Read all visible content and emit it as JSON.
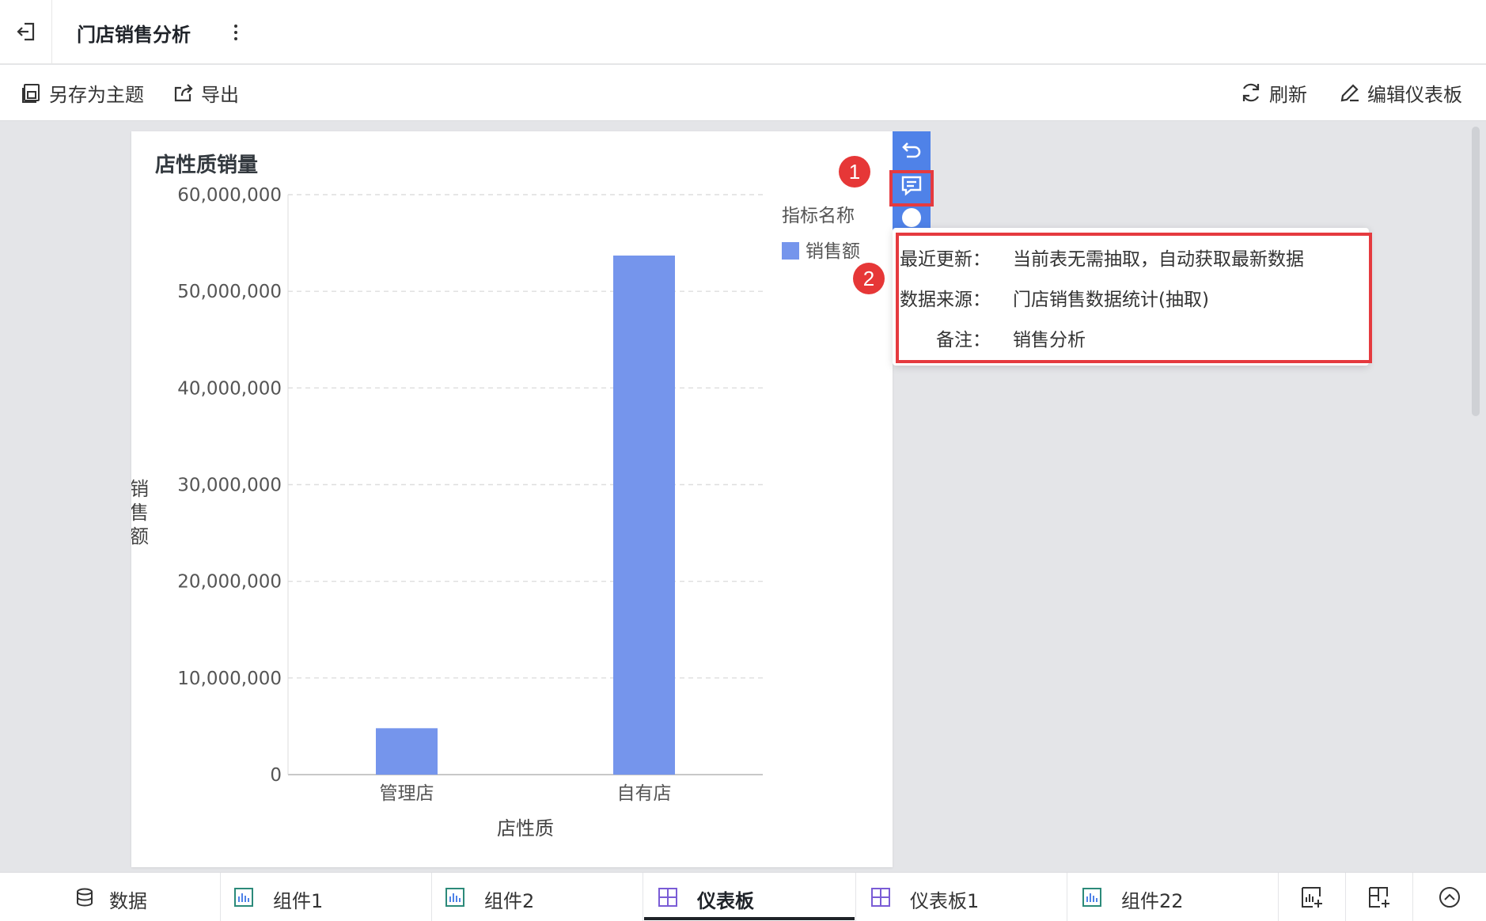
{
  "header": {
    "title": "门店销售分析"
  },
  "toolbar": {
    "save_as_theme": "另存为主题",
    "export": "导出",
    "refresh": "刷新",
    "edit_dashboard": "编辑仪表板"
  },
  "card": {
    "title": "店性质销量",
    "legend_title": "指标名称"
  },
  "chart_data": {
    "type": "bar",
    "title": "店性质销量",
    "categories": [
      "管理店",
      "自有店"
    ],
    "series": [
      {
        "name": "销售额",
        "values": [
          4800000,
          53700000
        ],
        "color": "#7595ec"
      }
    ],
    "xlabel": "店性质",
    "ylabel": "销售额",
    "ylim": [
      0,
      60000000
    ],
    "yticks": [
      0,
      10000000,
      20000000,
      30000000,
      40000000,
      50000000,
      60000000
    ],
    "ytick_labels": [
      "0",
      "10,000,000",
      "20,000,000",
      "30,000,000",
      "40,000,000",
      "50,000,000",
      "60,000,000"
    ],
    "grid": true,
    "legend_position": "top-right"
  },
  "badges": {
    "one": "1",
    "two": "2"
  },
  "popup": {
    "rows": [
      {
        "label": "最近更新：",
        "value": "当前表无需抽取，自动获取最新数据"
      },
      {
        "label": "数据来源：",
        "value": "门店销售数据统计(抽取)"
      },
      {
        "label": "备注：",
        "value": "销售分析"
      }
    ]
  },
  "bottom_tabs": [
    {
      "label": "数据",
      "icon": "database-icon"
    },
    {
      "label": "组件1",
      "icon": "bar-chart-icon"
    },
    {
      "label": "组件2",
      "icon": "bar-chart-icon"
    },
    {
      "label": "仪表板",
      "icon": "dashboard-icon",
      "active": true
    },
    {
      "label": "仪表板1",
      "icon": "dashboard-icon"
    },
    {
      "label": "组件22",
      "icon": "bar-chart-icon"
    }
  ],
  "colors": {
    "accent": "#4f82e8",
    "highlight": "#e53a3f",
    "bar": "#7595ec"
  }
}
